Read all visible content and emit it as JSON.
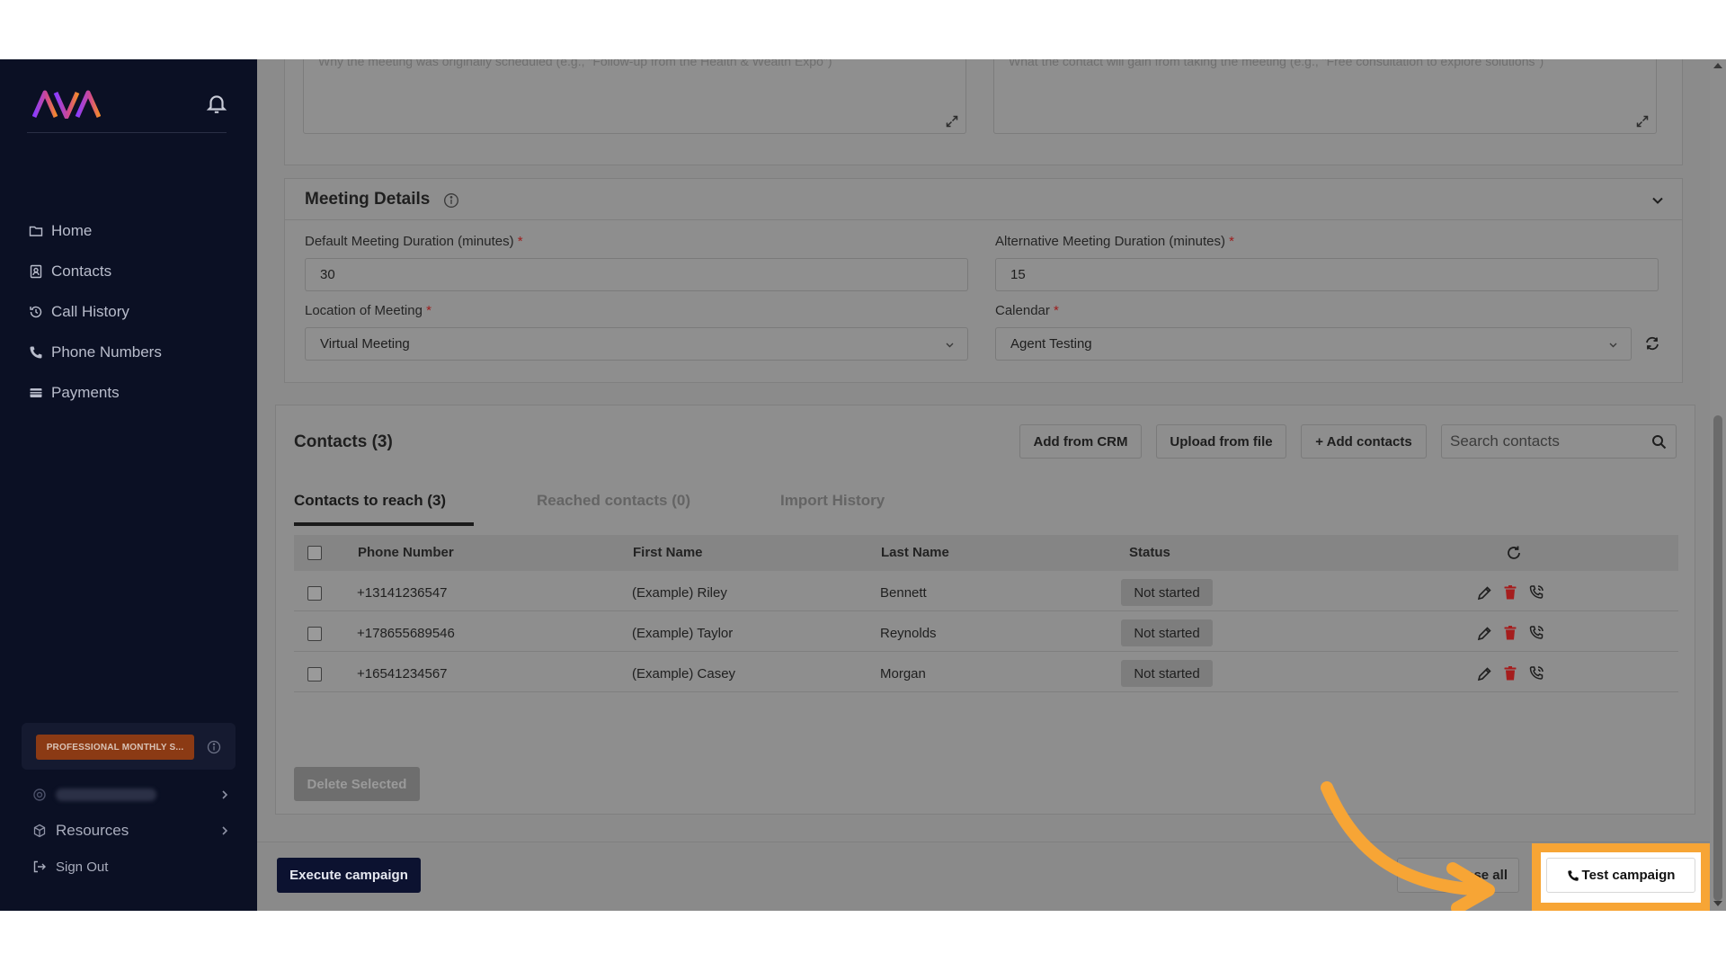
{
  "sidebar": {
    "logo_text": "AVA",
    "nav": [
      {
        "label": "Home",
        "icon": "folder-icon"
      },
      {
        "label": "Contacts",
        "icon": "address-book-icon"
      },
      {
        "label": "Call History",
        "icon": "history-icon"
      },
      {
        "label": "Phone Numbers",
        "icon": "phone-icon"
      },
      {
        "label": "Payments",
        "icon": "card-icon"
      }
    ],
    "plan_badge": "PROFESSIONAL MONTHLY S...",
    "resources_label": "Resources",
    "signout_label": "Sign Out"
  },
  "purpose": {
    "left_placeholder": "Why the meeting was originally scheduled (e.g., \"Follow-up from the Health & Wealth Expo\")",
    "right_placeholder": "What the contact will gain from taking the meeting (e.g., \"Free consultation to explore solutions\")"
  },
  "meeting": {
    "title": "Meeting Details",
    "default_duration_label": "Default Meeting Duration (minutes)",
    "default_duration_value": "30",
    "alt_duration_label": "Alternative Meeting Duration (minutes)",
    "alt_duration_value": "15",
    "location_label": "Location of Meeting",
    "location_value": "Virtual Meeting",
    "calendar_label": "Calendar",
    "calendar_value": "Agent Testing",
    "required_mark": "*"
  },
  "contacts": {
    "title": "Contacts (3)",
    "add_from_crm": "Add from CRM",
    "upload_from_file": "Upload from file",
    "add_contacts": "+ Add contacts",
    "search_placeholder": "Search contacts",
    "tabs": [
      "Contacts to reach (3)",
      "Reached contacts (0)",
      "Import History"
    ],
    "columns": [
      "Phone Number",
      "First Name",
      "Last Name",
      "Status"
    ],
    "rows": [
      {
        "phone": "+13141236547",
        "first": "(Example) Riley",
        "last": "Bennett",
        "status": "Not started"
      },
      {
        "phone": "+178655689546",
        "first": "(Example) Taylor",
        "last": "Reynolds",
        "status": "Not started"
      },
      {
        "phone": "+16541234567",
        "first": "(Example) Casey",
        "last": "Morgan",
        "status": "Not started"
      }
    ],
    "delete_selected": "Delete Selected"
  },
  "footer": {
    "execute": "Execute campaign",
    "collapse_partial": "pse all",
    "test": "Test campaign"
  },
  "colors": {
    "highlight": "#f7a535",
    "execute_bg": "#0c1230"
  }
}
